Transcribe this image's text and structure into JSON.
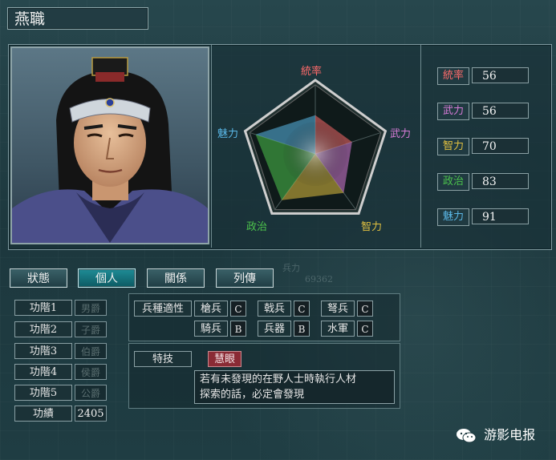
{
  "officer": {
    "name": "燕職"
  },
  "radar": {
    "labels": {
      "command": "統率",
      "war": "武力",
      "intelligence": "智力",
      "politics": "政治",
      "charisma": "魅力"
    },
    "colors": {
      "command": "#ff6b6b",
      "war": "#d87bd8",
      "intelligence": "#e0c040",
      "politics": "#4cc24c",
      "charisma": "#5ab8e8"
    }
  },
  "stats": [
    {
      "label": "統率",
      "value": "56",
      "color": "#ff6b6b"
    },
    {
      "label": "武力",
      "value": "56",
      "color": "#d87bd8"
    },
    {
      "label": "智力",
      "value": "70",
      "color": "#e0c040"
    },
    {
      "label": "政治",
      "value": "83",
      "color": "#4cc24c"
    },
    {
      "label": "魅力",
      "value": "91",
      "color": "#5ab8e8"
    }
  ],
  "stat_values_numeric": {
    "command": 56,
    "war": 56,
    "intelligence": 70,
    "politics": 83,
    "charisma": 91
  },
  "tabs": [
    {
      "label": "狀態"
    },
    {
      "label": "個人",
      "active": true
    },
    {
      "label": "關係"
    },
    {
      "label": "列傳"
    }
  ],
  "background_text": {
    "label": "兵力",
    "number": "69362"
  },
  "ranks": [
    {
      "label": "功階1",
      "value": "男爵"
    },
    {
      "label": "功階2",
      "value": "子爵"
    },
    {
      "label": "功階3",
      "value": "伯爵"
    },
    {
      "label": "功階4",
      "value": "侯爵"
    },
    {
      "label": "功階5",
      "value": "公爵"
    }
  ],
  "merit": {
    "label": "功績",
    "value": "2405"
  },
  "soldier_aptitude": {
    "title": "兵種適性",
    "cells": [
      {
        "label": "槍兵",
        "grade": "C"
      },
      {
        "label": "戟兵",
        "grade": "C"
      },
      {
        "label": "弩兵",
        "grade": "C"
      },
      {
        "label": "騎兵",
        "grade": "B"
      },
      {
        "label": "兵器",
        "grade": "B"
      },
      {
        "label": "水軍",
        "grade": "C"
      }
    ]
  },
  "skill": {
    "title": "特技",
    "name": "慧眼",
    "description_line1": "若有未發現的在野人士時執行人材",
    "description_line2": "探索的話，必定會發現"
  },
  "watermark": {
    "text": "游影电报"
  }
}
